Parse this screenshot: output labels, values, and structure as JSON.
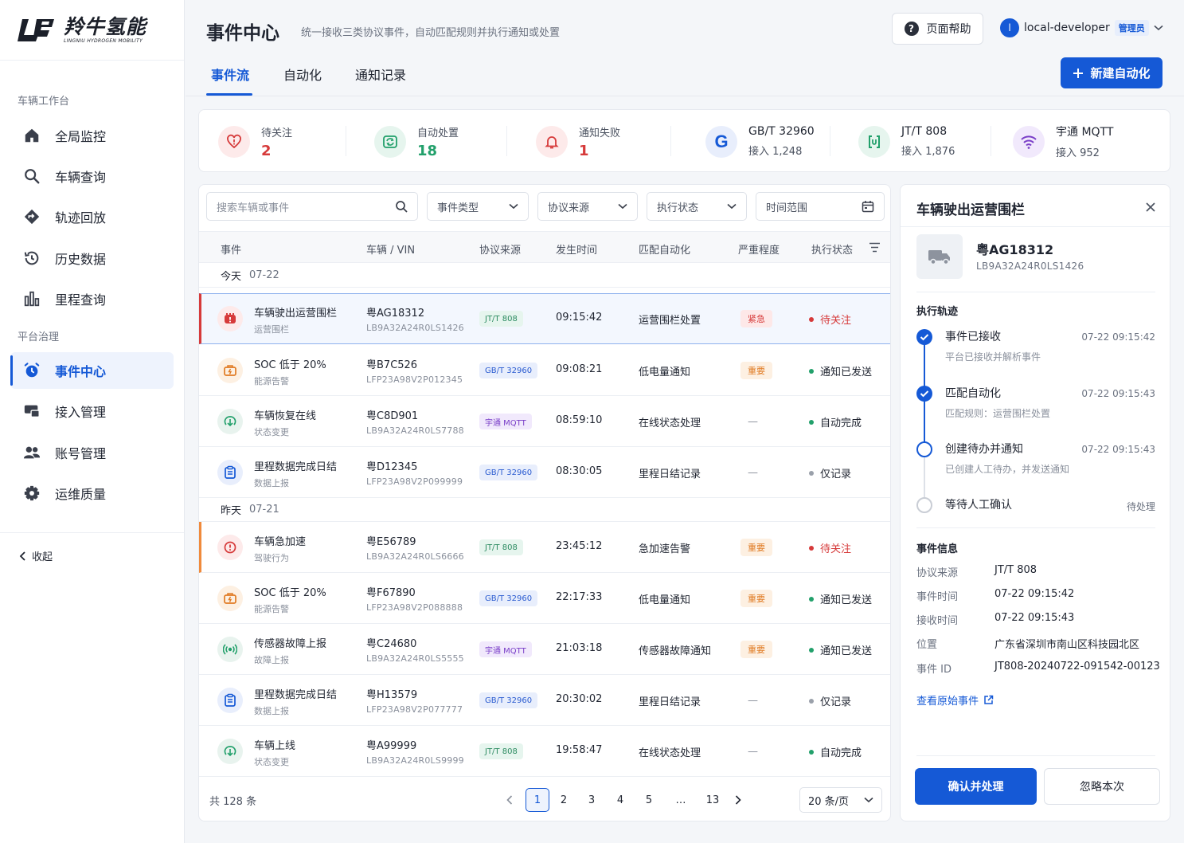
{
  "brand": {
    "name_cn": "羚牛氢能",
    "name_en": "LINGNIU HYDROGEN MOBILITY"
  },
  "sidebar": {
    "section_1": "车辆工作台",
    "section_2": "平台治理",
    "items": [
      {
        "label": "全局监控",
        "icon": "home-icon"
      },
      {
        "label": "车辆查询",
        "icon": "search-icon"
      },
      {
        "label": "轨迹回放",
        "icon": "route-icon"
      },
      {
        "label": "历史数据",
        "icon": "history-icon"
      },
      {
        "label": "里程查询",
        "icon": "bar-chart-icon"
      },
      {
        "label": "事件中心",
        "icon": "alarm-clock-icon",
        "active": true
      },
      {
        "label": "接入管理",
        "icon": "access-icon"
      },
      {
        "label": "账号管理",
        "icon": "users-icon"
      },
      {
        "label": "运维质量",
        "icon": "gear-icon"
      }
    ],
    "collapse": "收起"
  },
  "header": {
    "title": "事件中心",
    "subtitle": "统一接收三类协议事件，自动匹配规则并执行通知或处置",
    "help": "页面帮助",
    "user": "local-developer",
    "avatar_letter": "l",
    "role": "管理员",
    "new_button": "新建自动化"
  },
  "tabs": [
    "事件流",
    "自动化",
    "通知记录"
  ],
  "stats": {
    "pending": {
      "label": "待关注",
      "value": "2"
    },
    "auto": {
      "label": "自动处置",
      "value": "18"
    },
    "notify_fail": {
      "label": "通知失败",
      "value": "1"
    },
    "protocols": [
      {
        "name": "GB/T 32960",
        "sub": "接入  1,248"
      },
      {
        "name": "JT/T 808",
        "sub": "接入  1,876"
      },
      {
        "name": "宇通 MQTT",
        "sub": "接入  952"
      }
    ]
  },
  "filters": {
    "search_placeholder": "搜索车辆或事件",
    "type": "事件类型",
    "source": "协议来源",
    "status": "执行状态",
    "range": "时间范围"
  },
  "table": {
    "columns": [
      "事件",
      "车辆 / VIN",
      "协议来源",
      "发生时间",
      "匹配自动化",
      "严重程度",
      "执行状态"
    ],
    "groups": [
      {
        "label": "今天",
        "date": "07-22"
      },
      {
        "label": "昨天",
        "date": "07-21"
      }
    ],
    "rows": [
      {
        "title": "车辆驶出运营围栏",
        "sub": "运营围栏",
        "plate": "粤AG18312",
        "vin": "LB9A32A24R0LS1426",
        "proto": "JT/T 808",
        "time": "09:15:42",
        "auto": "运营围栏处置",
        "sev": "紧急",
        "status": "待关注",
        "status_color": "#d63a3a",
        "icon": "fence-alert-icon"
      },
      {
        "title": "SOC 低于 20%",
        "sub": "能源告警",
        "plate": "粤B7C526",
        "vin": "LFP23A98V2P012345",
        "proto": "GB/T 32960",
        "time": "09:08:21",
        "auto": "低电量通知",
        "sev": "重要",
        "status": "通知已发送",
        "status_color": "#22a06b",
        "icon": "battery-low-icon"
      },
      {
        "title": "车辆恢复在线",
        "sub": "状态变更",
        "plate": "粤C8D901",
        "vin": "LB9A32A24R0LS7788",
        "proto": "宇通 MQTT",
        "time": "08:59:10",
        "auto": "在线状态处理",
        "sev": "—",
        "status": "自动完成",
        "status_color": "#22a06b",
        "icon": "online-icon"
      },
      {
        "title": "里程数据完成日结",
        "sub": "数据上报",
        "plate": "粤D12345",
        "vin": "LFP23A98V2P099999",
        "proto": "GB/T 32960",
        "time": "08:30:05",
        "auto": "里程日结记录",
        "sev": "—",
        "status": "仅记录",
        "status_color": "#9aa0aa",
        "icon": "clipboard-icon"
      },
      {
        "title": "车辆急加速",
        "sub": "驾驶行为",
        "plate": "粤E56789",
        "vin": "LB9A32A24R0LS6666",
        "proto": "JT/T 808",
        "time": "23:45:12",
        "auto": "急加速告警",
        "sev": "重要",
        "status": "待关注",
        "status_color": "#d63a3a",
        "icon": "alert-circle-icon"
      },
      {
        "title": "SOC 低于 20%",
        "sub": "能源告警",
        "plate": "粤F67890",
        "vin": "LFP23A98V2P088888",
        "proto": "GB/T 32960",
        "time": "22:17:33",
        "auto": "低电量通知",
        "sev": "重要",
        "status": "通知已发送",
        "status_color": "#22a06b",
        "icon": "battery-low-icon"
      },
      {
        "title": "传感器故障上报",
        "sub": "故障上报",
        "plate": "粤C24680",
        "vin": "LB9A32A24R0LS5555",
        "proto": "宇通 MQTT",
        "time": "21:03:18",
        "auto": "传感器故障通知",
        "sev": "重要",
        "status": "通知已发送",
        "status_color": "#22a06b",
        "icon": "sensor-icon"
      },
      {
        "title": "里程数据完成日结",
        "sub": "数据上报",
        "plate": "粤H13579",
        "vin": "LFP23A98V2P077777",
        "proto": "GB/T 32960",
        "time": "20:30:02",
        "auto": "里程日结记录",
        "sev": "—",
        "status": "仅记录",
        "status_color": "#9aa0aa",
        "icon": "clipboard-icon"
      },
      {
        "title": "车辆上线",
        "sub": "状态变更",
        "plate": "粤A99999",
        "vin": "LB9A32A24R0LS9999",
        "proto": "JT/T 808",
        "time": "19:58:47",
        "auto": "在线状态处理",
        "sev": "—",
        "status": "自动完成",
        "status_color": "#22a06b",
        "icon": "online-icon"
      }
    ]
  },
  "pagination": {
    "total": "共 128 条",
    "pages": [
      "1",
      "2",
      "3",
      "4",
      "5",
      "…",
      "13"
    ],
    "current": "1",
    "per_page": "20 条/页"
  },
  "detail": {
    "title": "车辆驶出运营围栏",
    "plate": "粤AG18312",
    "vin": "LB9A32A24R0LS1426",
    "trace_title": "执行轨迹",
    "steps": [
      {
        "title": "事件已接收",
        "desc": "平台已接收并解析事件",
        "time": "07-22 09:15:42",
        "state": "done"
      },
      {
        "title": "匹配自动化",
        "desc": "匹配规则：运营围栏处置",
        "time": "07-22 09:15:43",
        "state": "done"
      },
      {
        "title": "创建待办并通知",
        "desc": "已创建人工待办，并发送通知",
        "time": "07-22 09:15:43",
        "state": "current"
      },
      {
        "title": "等待人工确认",
        "desc": "",
        "time": "待处理",
        "state": "todo"
      }
    ],
    "info_title": "事件信息",
    "info": [
      {
        "k": "协议来源",
        "v": "JT/T 808"
      },
      {
        "k": "事件时间",
        "v": "07-22 09:15:42"
      },
      {
        "k": "接收时间",
        "v": "07-22 09:15:43"
      },
      {
        "k": "位置",
        "v": "广东省深圳市南山区科技园北区"
      },
      {
        "k": "事件 ID",
        "v": "JT808-20240722-091542-00123"
      }
    ],
    "raw_link": "查看原始事件",
    "confirm": "确认并处理",
    "ignore": "忽略本次"
  }
}
